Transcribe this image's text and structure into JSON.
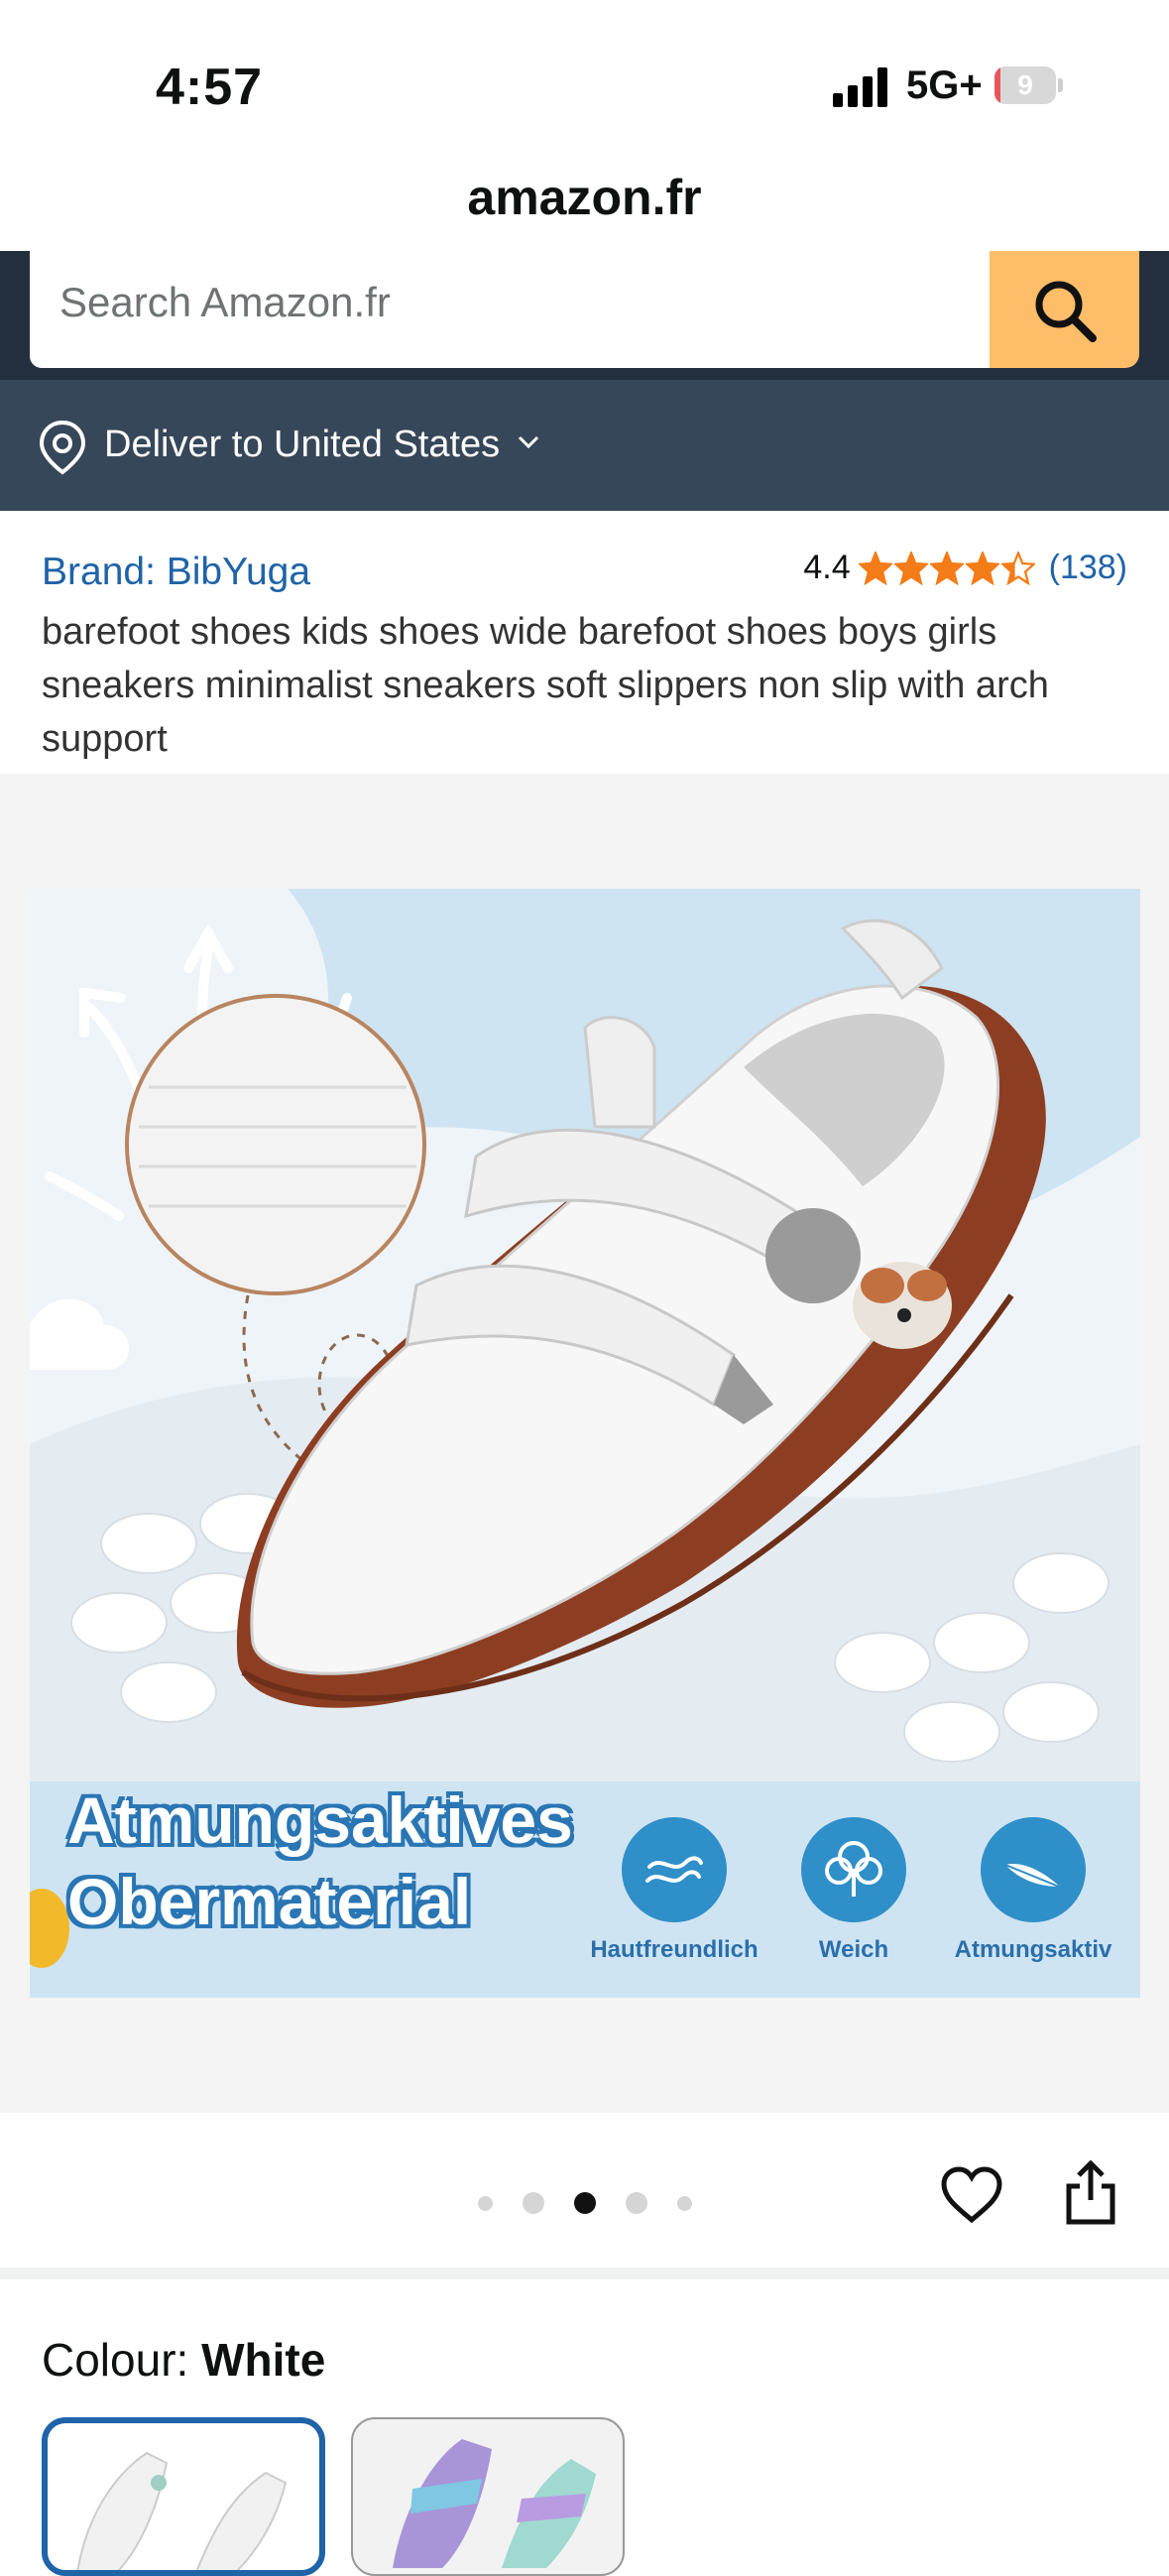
{
  "status": {
    "time": "4:57",
    "network": "5G+",
    "battery": "9",
    "battery_level_pct": 9
  },
  "browser": {
    "site": "amazon.fr"
  },
  "search": {
    "placeholder": "Search Amazon.fr"
  },
  "delivery": {
    "label": "Deliver to United States"
  },
  "product": {
    "brand": "Brand: BibYuga",
    "rating_value": "4.4",
    "rating_stars": 4.4,
    "rating_count": "(138)",
    "title": "barefoot shoes kids shoes wide barefoot shoes boys girls sneakers minimalist sneakers soft slippers non slip with arch support"
  },
  "image": {
    "headline_line1": "Atmungsaktives",
    "headline_line2": "Obermaterial",
    "features": [
      {
        "label": "Hautfreundlich",
        "icon": "waves-icon"
      },
      {
        "label": "Weich",
        "icon": "tree-icon"
      },
      {
        "label": "Atmungsaktiv",
        "icon": "feather-icon"
      }
    ]
  },
  "gallery": {
    "count": 5,
    "active": 3
  },
  "colour": {
    "label": "Colour:",
    "value": "White"
  },
  "colors": {
    "accent": "#febd69",
    "header": "#232f3e",
    "deliver_bar": "#37475a",
    "link": "#1f63a8",
    "star": "#f47c18"
  }
}
